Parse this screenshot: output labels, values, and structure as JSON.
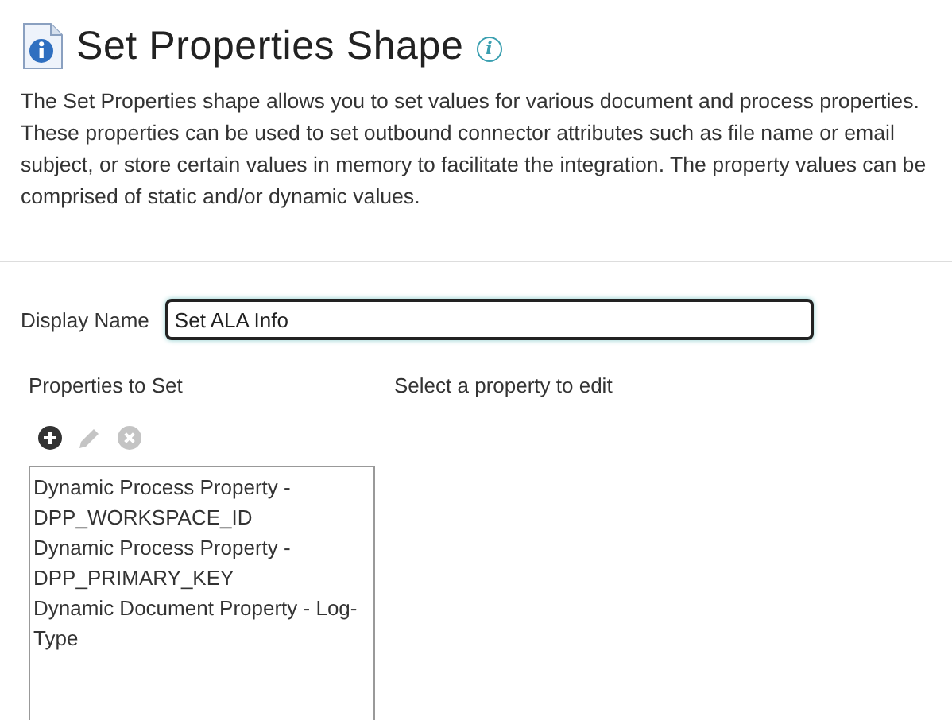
{
  "header": {
    "title": "Set Properties Shape",
    "info_glyph": "i"
  },
  "description": "The Set Properties shape allows you to set values for various document and process properties. These properties can be used to set outbound connector attributes such as file name or email subject, or store certain values in memory to facilitate the integration. The property values can be comprised of static and/or dynamic values.",
  "display_name": {
    "label": "Display Name",
    "value": "Set ALA Info"
  },
  "properties_panel": {
    "heading": "Properties to Set",
    "toolbar": [
      {
        "kind": "add",
        "disabled": false
      },
      {
        "kind": "edit",
        "disabled": true
      },
      {
        "kind": "delete",
        "disabled": true
      }
    ],
    "items": [
      {
        "label": "Dynamic Process Property - DPP_WORKSPACE_ID"
      },
      {
        "label": "Dynamic Process Property - DPP_PRIMARY_KEY"
      },
      {
        "label": "Dynamic Document Property - Log-Type"
      }
    ]
  },
  "editor_panel": {
    "hint": "Select a property to edit"
  }
}
